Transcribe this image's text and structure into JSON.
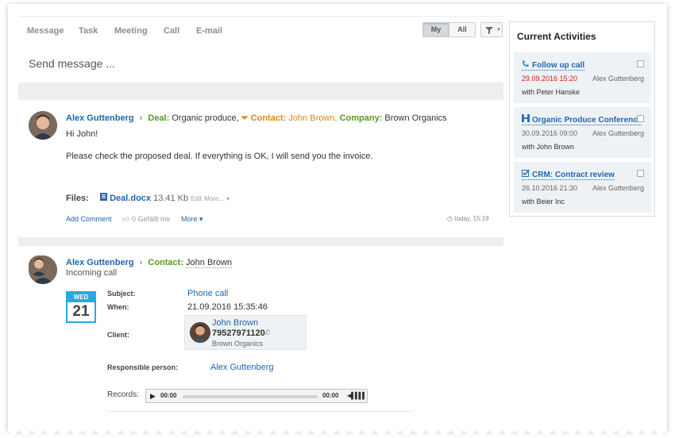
{
  "tabs": [
    "Message",
    "Task",
    "Meeting",
    "Call",
    "E-mail"
  ],
  "toggle": {
    "my": "My",
    "all": "All"
  },
  "composer": {
    "placeholder": "Send message ..."
  },
  "post1": {
    "author": "Alex Guttenberg",
    "deal_label": "Deal:",
    "deal_value": "Organic produce,",
    "contact_label": "Contact:",
    "contact_value": "John Brown,",
    "company_label": "Company:",
    "company_value": "Brown Organics",
    "greeting": "Hi John!",
    "body": "Please check the proposed deal. If everything is OK, I will send you the invoice.",
    "files_label": "Files:",
    "file_name": "Deal.docx",
    "file_size": "13.41 Kb",
    "file_edit": "Edit",
    "file_more": "More...",
    "add_comment": "Add Comment",
    "likes": "0 Gefällt mir",
    "more": "More",
    "time": "today, 15:19"
  },
  "post2": {
    "author": "Alex Guttenberg",
    "contact_label": "Contact:",
    "contact_value": "John Brown",
    "subtitle": "Incoming call",
    "calendar": {
      "weekday": "WED",
      "day": "21"
    },
    "subject_label": "Subject:",
    "subject_value": "Phone call",
    "when_label": "When:",
    "when_value": "21.09.2016 15:35:46",
    "client_label": "Client:",
    "client": {
      "name": "John Brown",
      "phone": "79527971120",
      "company": "Brown Organics"
    },
    "responsible_label": "Responsible person:",
    "responsible_value": "Alex Guttenberg",
    "records_label": "Records:",
    "player": {
      "current": "00:00",
      "total": "00:00",
      "progress": 0
    }
  },
  "panel": {
    "title": "Current Activities",
    "items": [
      {
        "title": "Follow up call",
        "date": "29.09.2016 15:20",
        "person": "Alex Guttenberg",
        "with": "with Peter Hanske",
        "icon": "phone-icon"
      },
      {
        "title": "Organic Produce Conference",
        "date": "30.09.2016 09:00",
        "person": "Alex Guttenberg",
        "with": "with John Brown",
        "icon": "meeting-icon"
      },
      {
        "title": "CRM: Contract review",
        "date": "26.10.2016 21:30",
        "person": "Alex Guttenberg",
        "with": "with Beier Inc",
        "icon": "task-icon"
      }
    ]
  },
  "colors": {
    "link": "#2067b0",
    "green": "#5a9b1b",
    "orange": "#d48a1a",
    "overdue": "#d11a1a",
    "calendar": "#28a9df"
  }
}
